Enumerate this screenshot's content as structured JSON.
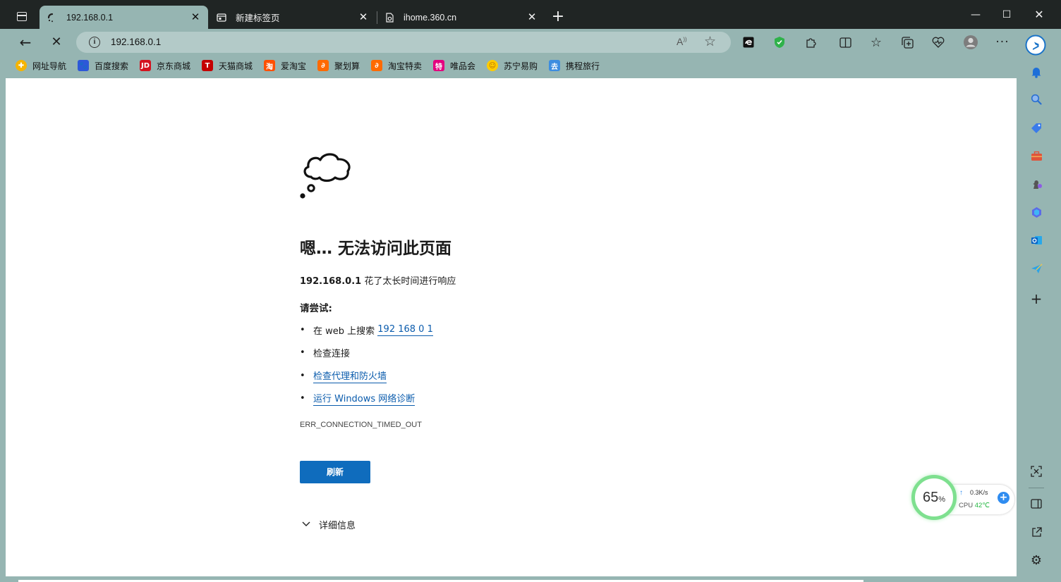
{
  "tabs": [
    {
      "title": "192.168.0.1",
      "active": true
    },
    {
      "title": "新建标签页",
      "active": false
    },
    {
      "title": "ihome.360.cn",
      "active": false
    }
  ],
  "address_bar": {
    "url": "192.168.0.1"
  },
  "bookmarks": [
    {
      "label": "网址导航",
      "icon": "globe-icon",
      "color": "#f5b400"
    },
    {
      "label": "百度搜索",
      "icon": "baidu-icon",
      "color": "#2e58d8"
    },
    {
      "label": "京东商城",
      "icon": "jd-icon",
      "color": "#d4131f"
    },
    {
      "label": "天猫商城",
      "icon": "tmall-icon",
      "color": "#c40000"
    },
    {
      "label": "爱淘宝",
      "icon": "taobao-icon",
      "color": "#ff5000"
    },
    {
      "label": "聚划算",
      "icon": "juhuasuan-icon",
      "color": "#ff6a00"
    },
    {
      "label": "淘宝特卖",
      "icon": "taobao-sale-icon",
      "color": "#ff6a00"
    },
    {
      "label": "唯品会",
      "icon": "vip-icon",
      "color": "#e4007f"
    },
    {
      "label": "苏宁易购",
      "icon": "suning-icon",
      "color": "#ffcc00"
    },
    {
      "label": "携程旅行",
      "icon": "ctrip-icon",
      "color": "#3d8de0"
    }
  ],
  "error_page": {
    "title": "嗯… 无法访问此页面",
    "host": "192.168.0.1",
    "desc_suffix": " 花了太长时间进行响应",
    "try_label": "请尝试:",
    "suggestions": {
      "search_prefix": "在 web 上搜索 ",
      "search_link": "192 168 0 1",
      "check_connection": "检查连接",
      "check_proxy": "检查代理和防火墙",
      "run_diagnostics": "运行 Windows 网络诊断"
    },
    "error_code": "ERR_CONNECTION_TIMED_OUT",
    "refresh_label": "刷新",
    "details_label": "详细信息"
  },
  "monitor_widget": {
    "percent": "65",
    "percent_unit": "%",
    "net_speed": "0.3K/s",
    "cpu_label": "CPU",
    "cpu_temp": "42℃"
  },
  "colors": {
    "frame": "#96b5b2",
    "tabstrip": "#202524",
    "link": "#0b5cad",
    "button": "#0f6cbd"
  }
}
